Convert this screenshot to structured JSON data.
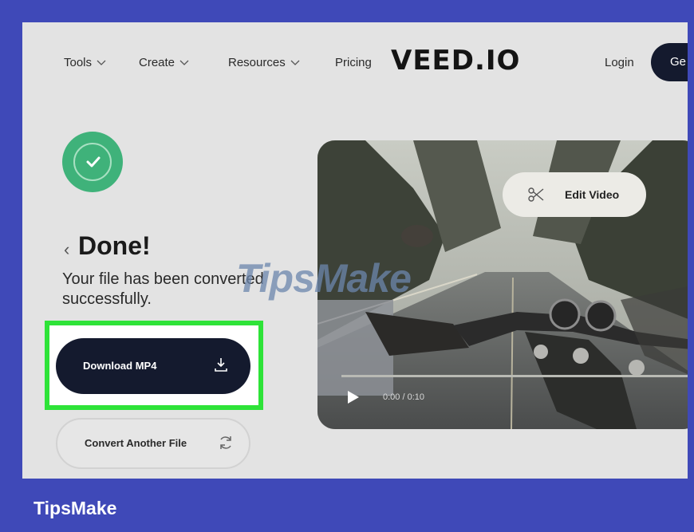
{
  "nav": {
    "items": [
      "Tools",
      "Create",
      "Resources",
      "Pricing"
    ],
    "logo": "VEED.IO",
    "login": "Login",
    "get_started": "Ge"
  },
  "status": {
    "back_glyph": "‹",
    "title": "Done!",
    "message": "Your file has been converted successfully."
  },
  "actions": {
    "download_label": "Download MP4",
    "convert_label": "Convert Another File"
  },
  "video": {
    "edit_label": "Edit Video",
    "time": "0:00 / 0:10"
  },
  "watermark": "TipsMake",
  "footer_brand": "TipsMake",
  "colors": {
    "frame_border": "#3f49b8",
    "highlight": "#2ee338",
    "button_dark": "#141a2e",
    "success_green": "#3fb27a"
  },
  "icons": [
    "chevron-down-icon",
    "check-icon",
    "download-icon",
    "refresh-icon",
    "scissors-icon",
    "play-icon"
  ]
}
